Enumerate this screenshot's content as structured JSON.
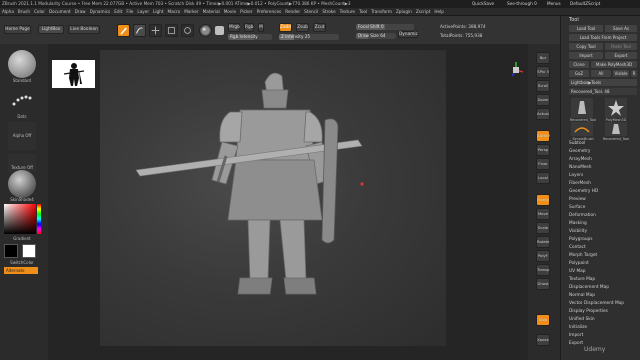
{
  "window": {
    "title": "ZBrush 2021.1.1     Modularity Course  • Free Mem 22.077GB • Active Mem 703 • Scratch Disk 49 • Timer▶0.001 ATime▶0.012 • PolyCount▶770.386 KP • MeshCount▶3",
    "right_items": [
      "QuickSave",
      "See-through 0",
      "Menus",
      "DefaultZScript"
    ]
  },
  "menubar": [
    "Alpha",
    "Brush",
    "Color",
    "Document",
    "Draw",
    "Dynamics",
    "Edit",
    "File",
    "Layer",
    "Light",
    "Macro",
    "Marker",
    "Material",
    "Movie",
    "Picker",
    "Preferences",
    "Render",
    "Stencil",
    "Stroke",
    "Texture",
    "Tool",
    "Transform",
    "Zplugin",
    "Zscript",
    "Help"
  ],
  "toolbar": {
    "home_page": "Home Page",
    "lightbox": "LightBox",
    "live_boolean": "Live Boolean",
    "edit": "Edit",
    "draw": "Draw",
    "move": "Move",
    "scale": "Scale",
    "rotate": "Rotate",
    "mrgb": "Mrgb",
    "rgb": "Rgb",
    "m": "M",
    "zadd": "Zadd",
    "zsub": "Zsub",
    "zcut": "Zcut",
    "rgb_intensity": "Rgb Intensity",
    "z_intensity": "Z Intensity 25",
    "focal_shift": "Focal Shift 0",
    "draw_size": "Draw Size 64",
    "dynamic": "Dynamic",
    "active_points": "ActivePoints: 388,974",
    "total_points": "TotalPoints: 755,938"
  },
  "left_shelf": {
    "brush_label": "Standard",
    "stroke_label": "Dots",
    "alpha_label": "Alpha Off",
    "texture_label": "Texture Off",
    "material_label": "SkinShade4",
    "gradient_label": "Gradient",
    "switch_color": "SwitchColor",
    "alternate": "Alternate"
  },
  "right_shelf": [
    "Bpr",
    "SPix 3",
    "Scroll",
    "Zoom",
    "Actual",
    "AAHalf",
    "Persp",
    "Floor",
    "Local",
    "Frame",
    "Move",
    "Scale",
    "Rotate",
    "PolyF",
    "Transp",
    "Ghost",
    "Solo",
    "Xpose"
  ],
  "tool_panel": {
    "header": "Tool",
    "buttons": [
      "Load Tool",
      "Save As",
      "Load Tools From Project",
      "Copy Tool",
      "Paste Tool",
      "Import",
      "Export",
      "Clone",
      "Make PolyMesh3D",
      "GoZ",
      "All",
      "Visible",
      "R"
    ],
    "lightbox_tools": "Lightbox▶Tools",
    "recovered_tool": "Recovered_Tool. 48",
    "tool_thumbs": [
      "Recovered_Tool",
      "PolyMesh3D",
      "SimpleBrush",
      "Recovered_Tool"
    ],
    "menu": [
      "Subtool",
      "Geometry",
      "ArrayMesh",
      "NanoMesh",
      "Layers",
      "FiberMesh",
      "Geometry HD",
      "Preview",
      "Surface",
      "Deformation",
      "Masking",
      "Visibility",
      "Polygroups",
      "Contact",
      "Morph Target",
      "Polypaint",
      "UV Map",
      "Texture Map",
      "Displacement Map",
      "Normal Map",
      "Vector Displacement Map",
      "Display Properties",
      "Unified Skin",
      "Initialize",
      "Import",
      "Export"
    ]
  },
  "watermark": "Udemy",
  "colors": {
    "accent": "#ef8f1a",
    "panel": "#2f2f2f",
    "canvas": "#3a3a3a"
  }
}
